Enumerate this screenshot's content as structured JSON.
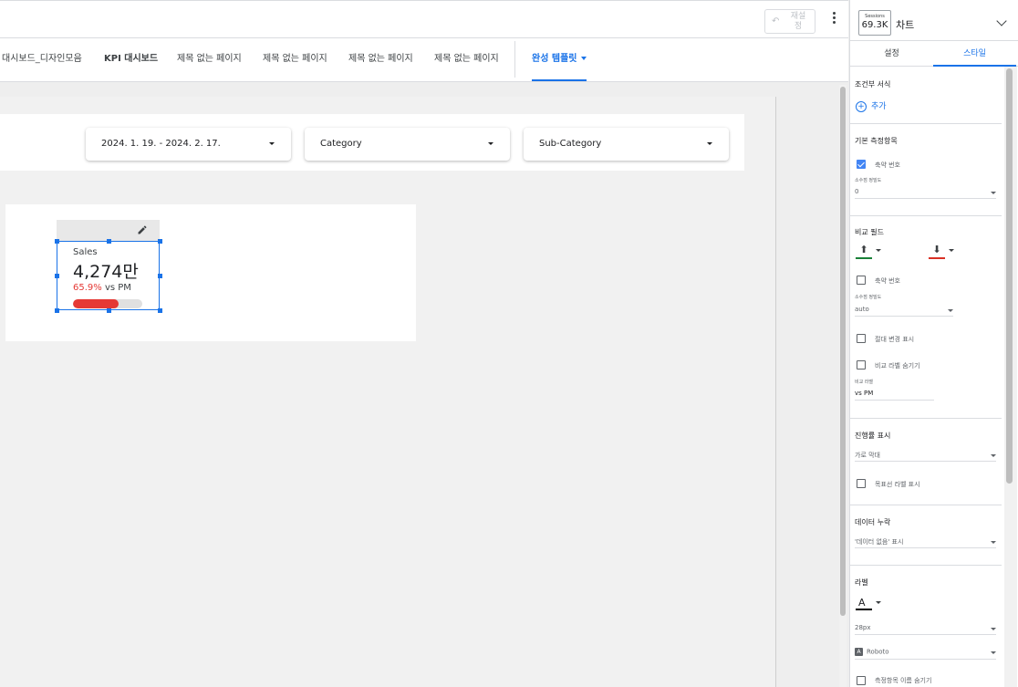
{
  "toolbar": {
    "reset_label": "재설정"
  },
  "tabs": [
    {
      "label": "대시보드_디자인모음"
    },
    {
      "label": "KPI 대시보드"
    },
    {
      "label": "제목 없는 페이지"
    },
    {
      "label": "제목 없는 페이지"
    },
    {
      "label": "제목 없는 페이지"
    },
    {
      "label": "제목 없는 페이지"
    },
    {
      "label": "완성 템플릿"
    }
  ],
  "filters": {
    "date": "2024. 1. 19. - 2024. 2. 17.",
    "category": "Category",
    "subcategory": "Sub-Category"
  },
  "scorecard": {
    "label": "Sales",
    "value": "4,274만",
    "compare_pct": "65.9%",
    "compare_label": "vs PM",
    "progress": 0.66,
    "progress_color": "#e53935"
  },
  "panel": {
    "sessions_label": "Sessions",
    "sessions_value": "69.3K",
    "title": "차트",
    "tab_setup": "설정",
    "tab_style": "스타일",
    "conditional": {
      "title": "조건부 서식",
      "add": "추가"
    },
    "metric": {
      "title": "기본 측정항목",
      "compact": "축약 번호",
      "decimal_label": "소수점 정밀도",
      "decimal_value": "0"
    },
    "compare": {
      "title": "비교 필드",
      "up_color": "#188038",
      "down_color": "#d93025",
      "compact": "축약 번호",
      "decimal_label": "소수점 정밀도",
      "decimal_value": "auto",
      "absolute": "절대 변경 표시",
      "hide_label": "비교 라벨 숨기기",
      "label_caption": "비교 라벨",
      "label_value": "vs PM"
    },
    "progress": {
      "title": "진행률 표시",
      "type": "가로 막대",
      "target_label": "목표선 라벨 표시"
    },
    "missing": {
      "title": "데이터 누락",
      "value": "'데이터 없음' 표시"
    },
    "label": {
      "title": "라벨",
      "font_glyph": "A",
      "size": "28px",
      "font_icon": "A",
      "font": "Roboto",
      "hide_metric": "측정항목 이름 숨기기"
    }
  }
}
